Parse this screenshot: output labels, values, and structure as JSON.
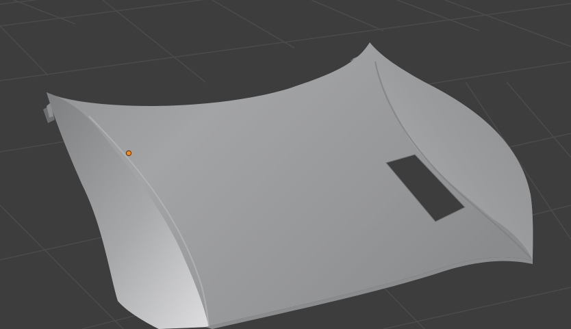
{
  "viewport": {
    "mode": "3d-viewport",
    "colors": {
      "background": "#3d3d3d",
      "grid_line": "#4b4b4b",
      "mesh_surface": "#9a9b9d",
      "mesh_highlight": "#d9d9db",
      "mesh_shadow": "#6f7072",
      "cutout": "#3d3d3d",
      "origin_point": "#f08c1c"
    },
    "objects": [
      {
        "name_icon": "car-hood-mesh",
        "features": [
          "hood-scoop-cutout",
          "left-hinge-tab",
          "right-hinge-tab"
        ]
      }
    ],
    "origin_marker": "object-origin-dot"
  }
}
